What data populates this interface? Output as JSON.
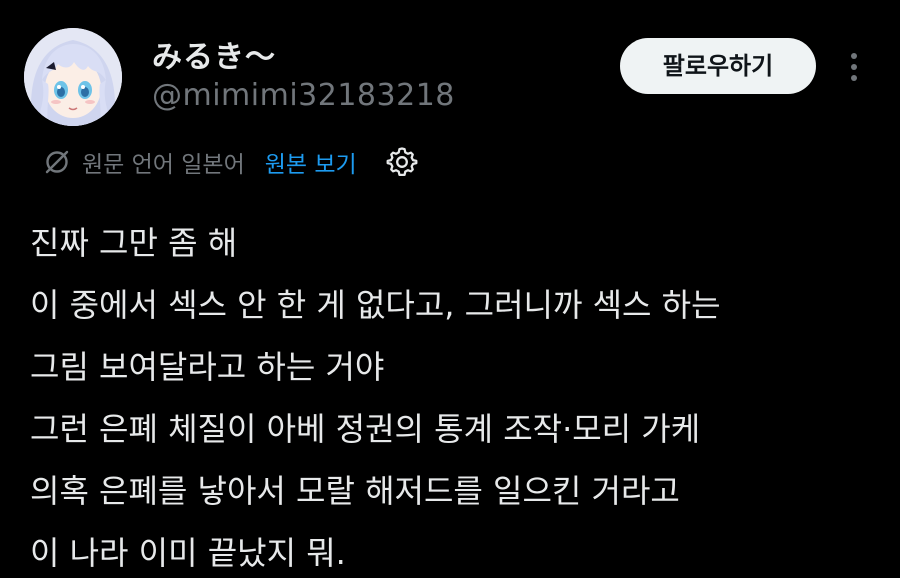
{
  "user": {
    "display_name": "みるき〜",
    "handle": "@mimimi32183218",
    "avatar": "anime-girl-avatar"
  },
  "actions": {
    "follow_label": "팔로우하기",
    "more_icon": "more-vertical-icon"
  },
  "translation": {
    "icon": "translate-icon",
    "source_language_label": "원문 언어 일본어",
    "view_original_label": "원본 보기",
    "settings_icon": "gear-icon"
  },
  "tweet": {
    "lines": [
      "진짜 그만 좀 해",
      "이 중에서 섹스 안 한 게 없다고, 그러니까 섹스 하는",
      "그림 보여달라고 하는 거야",
      "그런 은폐 체질이 아베 정권의 통계 조작·모리 가케",
      "의혹 은폐를 낳아서 모랄 해저드를 일으킨 거라고",
      "이 나라 이미 끝났지 뭐."
    ]
  },
  "colors": {
    "background": "#000000",
    "text_primary": "#e7e9ea",
    "text_secondary": "#71767b",
    "link": "#1d9bf0",
    "button_bg": "#eff3f4"
  }
}
